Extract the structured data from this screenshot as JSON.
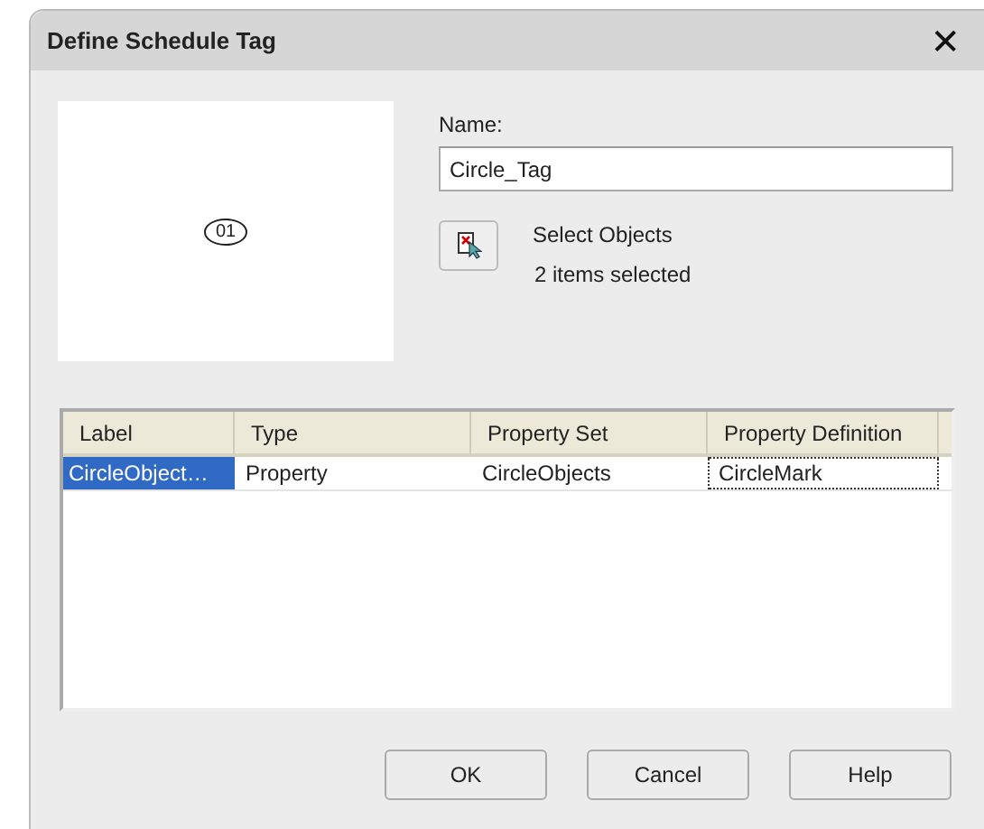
{
  "window": {
    "title": "Define Schedule Tag",
    "close": "✕"
  },
  "preview": {
    "tag_text": "01"
  },
  "name_field": {
    "label": "Name:",
    "value": "Circle_Tag"
  },
  "select_objects": {
    "label": "Select Objects",
    "status": "2 items selected"
  },
  "table": {
    "columns": [
      "Label",
      "Type",
      "Property Set",
      "Property Definition"
    ],
    "rows": [
      {
        "cells": [
          {
            "text": "CircleObject…",
            "selected": true,
            "focused": false
          },
          {
            "text": "Property",
            "selected": false,
            "focused": false
          },
          {
            "text": "CircleObjects",
            "selected": false,
            "focused": false
          },
          {
            "text": "CircleMark",
            "selected": false,
            "focused": true
          }
        ]
      }
    ]
  },
  "buttons": [
    "OK",
    "Cancel",
    "Help"
  ]
}
